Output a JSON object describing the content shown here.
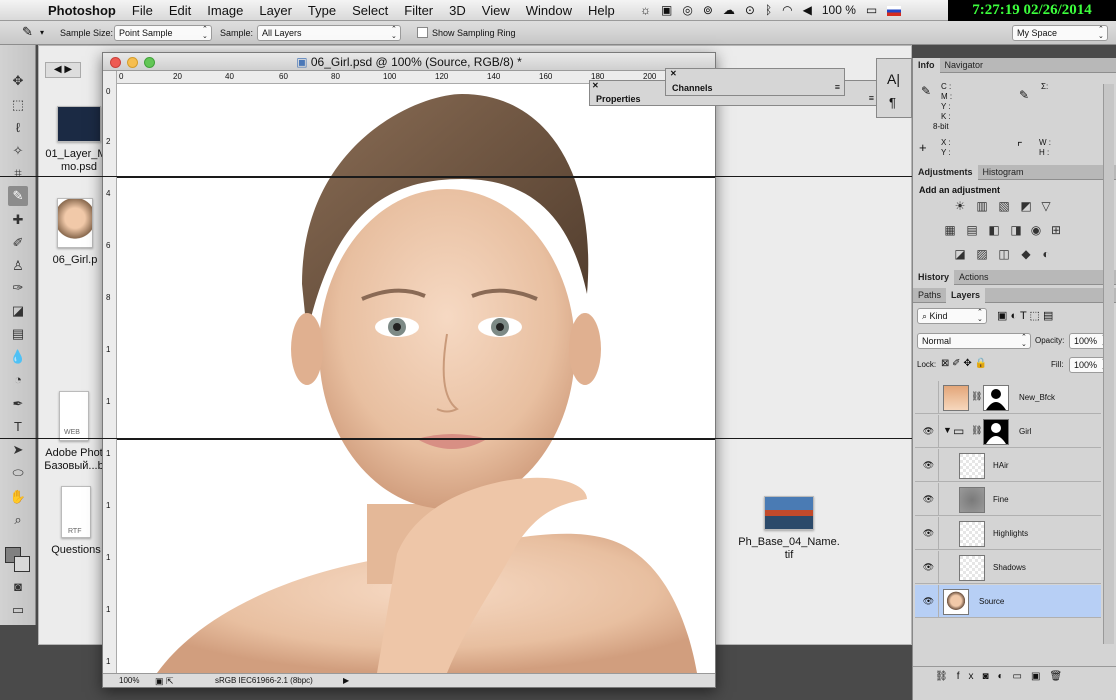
{
  "menubar": {
    "app": "Photoshop",
    "items": [
      "File",
      "Edit",
      "Image",
      "Layer",
      "Type",
      "Select",
      "Filter",
      "3D",
      "View",
      "Window",
      "Help"
    ],
    "battery": "100 %",
    "clock": "7:27:19  02/26/2014"
  },
  "options": {
    "sample_size_label": "Sample Size:",
    "sample_size_value": "Point Sample",
    "sample_label": "Sample:",
    "sample_value": "All Layers",
    "sampling_ring": "Show Sampling Ring",
    "workspace": "My Space"
  },
  "desktop_files": [
    {
      "name_line1": "01_Layer_Ma",
      "name_line2": "mo.psd"
    },
    {
      "name_line1": "06_Girl.p",
      "name_line2": ""
    },
    {
      "name_line1": "Adobe Phot",
      "name_line2": "Базовый...b"
    },
    {
      "name_line1": "Questions",
      "name_line2": ""
    },
    {
      "name_line1": "Ph_Base_04_Name.",
      "name_line2": "tif"
    }
  ],
  "file_icon_labels": {
    "web": "WEB",
    "rtf": "RTF"
  },
  "document": {
    "title": "06_Girl.psd @ 100% (Source, RGB/8) *",
    "ruler_h": [
      "0",
      "20",
      "40",
      "60",
      "80",
      "100",
      "120",
      "140",
      "160",
      "180",
      "200"
    ],
    "ruler_v": [
      "0",
      "2",
      "4",
      "6",
      "8",
      "1",
      "1",
      "1",
      "1",
      "1",
      "1",
      "1"
    ],
    "zoom": "100%",
    "profile": "sRGB IEC61966-2.1 (8bpc)"
  },
  "panels": {
    "properties": "Properties",
    "channels": "Channels",
    "info_tab": "Info",
    "navigator_tab": "Navigator",
    "info_cmyk": [
      "C :",
      "M :",
      "Y :",
      "K :"
    ],
    "info_bit": "8-bit",
    "info_sigma": "Σ:",
    "info_xy": [
      "X :",
      "Y :"
    ],
    "info_wh": [
      "W :",
      "H :"
    ],
    "adjustments_tab": "Adjustments",
    "histogram_tab": "Histogram",
    "add_adjustment": "Add an adjustment",
    "history_tab": "History",
    "actions_tab": "Actions",
    "paths_tab": "Paths",
    "layers_tab": "Layers"
  },
  "layers_panel": {
    "kind": "Kind",
    "blend": "Normal",
    "opacity_label": "Opacity:",
    "opacity": "100%",
    "lock_label": "Lock:",
    "fill_label": "Fill:",
    "fill": "100%",
    "layers": [
      {
        "name": "New_Bfck",
        "visible": false,
        "selected": false
      },
      {
        "name": "Girl",
        "visible": true,
        "selected": false
      },
      {
        "name": "HAir",
        "visible": true,
        "selected": false
      },
      {
        "name": "Fine",
        "visible": true,
        "selected": false
      },
      {
        "name": "Highlights",
        "visible": true,
        "selected": false
      },
      {
        "name": "Shadows",
        "visible": true,
        "selected": false
      },
      {
        "name": "Source",
        "visible": true,
        "selected": true
      }
    ]
  }
}
